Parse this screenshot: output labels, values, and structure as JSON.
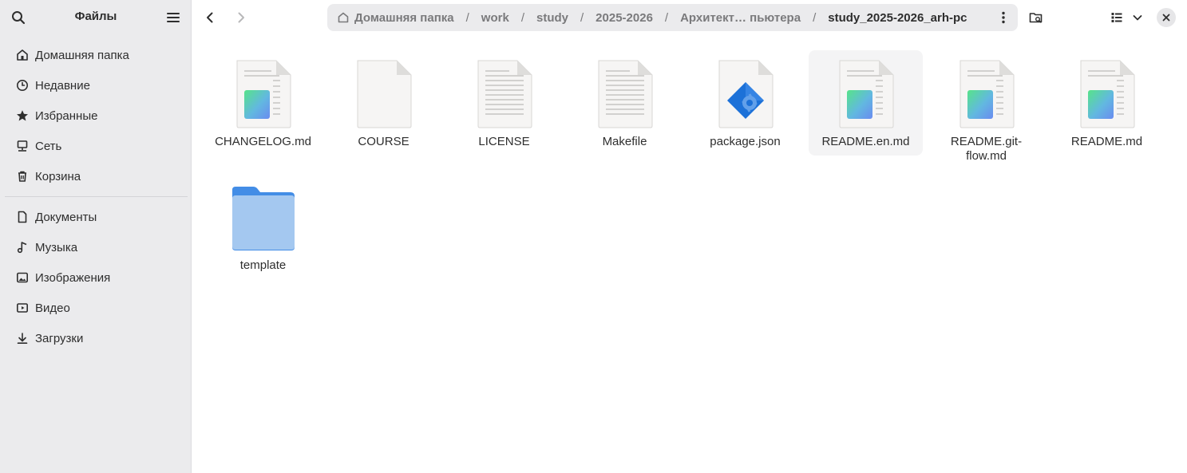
{
  "colors": {
    "sidebar_bg": "#ebebed",
    "accent_folder": "#438de6",
    "folder_light": "#a4c8f0",
    "text": "#2e2e2e",
    "muted": "#7a7a7c"
  },
  "sidebar": {
    "title": "Файлы",
    "places": [
      {
        "label": "Домашняя папка",
        "icon": "home-icon"
      },
      {
        "label": "Недавние",
        "icon": "clock-icon"
      },
      {
        "label": "Избранные",
        "icon": "star-icon"
      },
      {
        "label": "Сеть",
        "icon": "network-icon"
      },
      {
        "label": "Корзина",
        "icon": "trash-icon"
      }
    ],
    "bookmarks": [
      {
        "label": "Документы",
        "icon": "document-icon"
      },
      {
        "label": "Музыка",
        "icon": "music-icon"
      },
      {
        "label": "Изображения",
        "icon": "image-icon"
      },
      {
        "label": "Видео",
        "icon": "video-icon"
      },
      {
        "label": "Загрузки",
        "icon": "download-icon"
      }
    ]
  },
  "pathbar": {
    "crumbs": [
      "Домашняя папка",
      "work",
      "study",
      "2025-2026",
      "Архитект… пьютера",
      "study_2025-2026_arh-pc"
    ],
    "separator": "/"
  },
  "files": [
    {
      "name": "CHANGELOG.md",
      "kind": "markdown"
    },
    {
      "name": "COURSE",
      "kind": "blank"
    },
    {
      "name": "LICENSE",
      "kind": "text"
    },
    {
      "name": "Makefile",
      "kind": "text"
    },
    {
      "name": "package.json",
      "kind": "json"
    },
    {
      "name": "README.en.md",
      "kind": "markdown",
      "selected": true
    },
    {
      "name": "README.git-flow.md",
      "kind": "markdown"
    },
    {
      "name": "README.md",
      "kind": "markdown"
    }
  ],
  "folders": [
    {
      "name": "template",
      "kind": "folder"
    }
  ]
}
